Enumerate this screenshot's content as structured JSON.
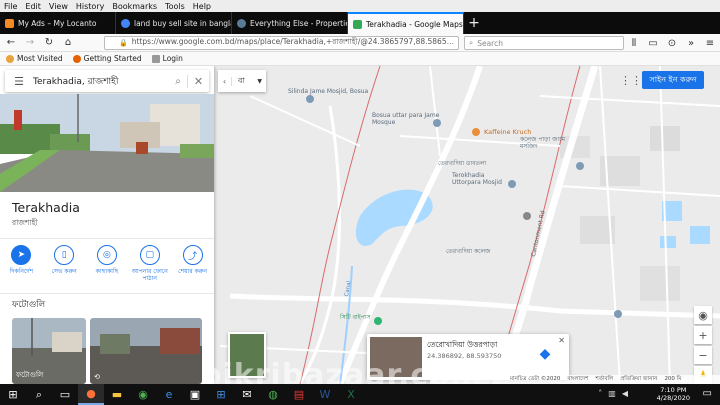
{
  "menubar": [
    "File",
    "Edit",
    "View",
    "History",
    "Bookmarks",
    "Tools",
    "Help"
  ],
  "tabs": [
    {
      "title": "My Ads – My Locanto",
      "color": "#f28b24",
      "active": false
    },
    {
      "title": "land buy sell site in bangladesh",
      "color": "#4285f4",
      "active": false
    },
    {
      "title": "Everything Else - Properties & Re",
      "color": "#5a7a9a",
      "active": false
    },
    {
      "title": "Terakhadia - Google Maps",
      "color": "#34a853",
      "active": true
    }
  ],
  "url": "https://www.google.com.bd/maps/place/Terakhadia,+রাজশাহী/@24.3865797,88.5865",
  "search_placeholder": "Search",
  "bookmarks": [
    {
      "label": "Most Visited",
      "color": "#e8a33c"
    },
    {
      "label": "Getting Started",
      "color": "#e66000"
    },
    {
      "label": "Login",
      "color": "#999999"
    }
  ],
  "panel": {
    "search_value": "Terakhadia, রাজশাহী",
    "place_name": "Terakhadia",
    "place_sub": "রাজশাহী",
    "actions": [
      {
        "label": "দিকনির্দেশ",
        "icon": "directions-icon"
      },
      {
        "label": "সেভ করুন",
        "icon": "bookmark-icon"
      },
      {
        "label": "কাছাকাছি",
        "icon": "nearby-icon"
      },
      {
        "label": "আপনার ফোনে পাঠান",
        "icon": "phone-icon"
      },
      {
        "label": "শেয়ার করুন",
        "icon": "share-icon"
      }
    ],
    "photos_title": "ফটোগুলি",
    "photo_caption": "ফটোগুলি"
  },
  "map": {
    "layer_lang": "বা",
    "signin_label": "সাইন ইন করুন",
    "labels": [
      "Silinda Jame Mosjid, Bosua",
      "Bosua uttar para Jame Mosque",
      "Kaffeine Kruch",
      "তেরখাদিয়া ডাবতলা",
      "Terokhadia Uttorpara Mosjid",
      "তেরখাদিয়া কলেজ",
      "Cantonment Rd",
      "Canal",
      "সিটি বাইপাস",
      "কলেজ পাড়া জামে মসজিদ"
    ]
  },
  "infocard": {
    "title": "তেরোখাদিয়া উত্তরপাড়া",
    "coords": "24.386892, 88.593750"
  },
  "footer": [
    "মানচিত্র ডেটা ©2020",
    "বাংলাদেশ",
    "শর্তাবলি",
    "প্রতিক্রিয়া জানান",
    "200 মি"
  ],
  "watermark": "bikribazaar.com",
  "taskbar": {
    "time": "7:10 PM",
    "date": "4/28/2020"
  }
}
